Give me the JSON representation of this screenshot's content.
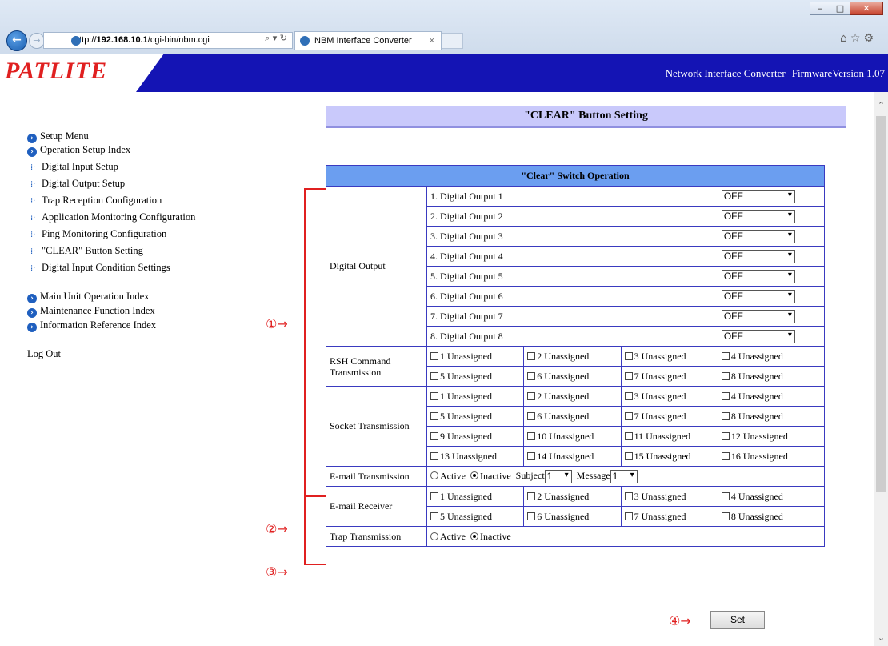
{
  "browser": {
    "url_prefix": "http://",
    "url_host": "192.168.10.1",
    "url_path": "/cgi-bin/nbm.cgi",
    "tab_title": "NBM Interface Converter"
  },
  "header": {
    "logo": "PATLITE",
    "product": "Network Interface Converter",
    "firmware": "FirmwareVersion 1.07"
  },
  "sidebar": {
    "setup_menu": "Setup Menu",
    "operation_index": "Operation Setup Index",
    "items": [
      "Digital Input Setup",
      "Digital Output Setup",
      "Trap Reception Configuration",
      "Application Monitoring Configuration",
      "Ping Monitoring Configuration",
      "\"CLEAR\" Button Setting",
      "Digital Input Condition Settings"
    ],
    "main_unit_index": "Main Unit Operation Index",
    "maintenance_index": "Maintenance Function Index",
    "info_index": "Information Reference Index",
    "logout": "Log Out"
  },
  "page": {
    "title": "\"CLEAR\" Button Setting",
    "table_header": "\"Clear\" Switch Operation"
  },
  "digital_output": {
    "label": "Digital Output",
    "rows": [
      {
        "name": "1. Digital Output 1",
        "value": "OFF"
      },
      {
        "name": "2. Digital Output 2",
        "value": "OFF"
      },
      {
        "name": "3. Digital Output 3",
        "value": "OFF"
      },
      {
        "name": "4. Digital Output 4",
        "value": "OFF"
      },
      {
        "name": "5. Digital Output 5",
        "value": "OFF"
      },
      {
        "name": "6. Digital Output 6",
        "value": "OFF"
      },
      {
        "name": "7. Digital Output 7",
        "value": "OFF"
      },
      {
        "name": "8. Digital Output 8",
        "value": "OFF"
      }
    ]
  },
  "rsh": {
    "label": "RSH Command Transmission",
    "items": [
      "1 Unassigned",
      "2 Unassigned",
      "3 Unassigned",
      "4 Unassigned",
      "5 Unassigned",
      "6 Unassigned",
      "7 Unassigned",
      "8 Unassigned"
    ]
  },
  "socket": {
    "label": "Socket Transmission",
    "items": [
      "1 Unassigned",
      "2 Unassigned",
      "3 Unassigned",
      "4 Unassigned",
      "5 Unassigned",
      "6 Unassigned",
      "7 Unassigned",
      "8 Unassigned",
      "9 Unassigned",
      "10 Unassigned",
      "11 Unassigned",
      "12 Unassigned",
      "13 Unassigned",
      "14 Unassigned",
      "15 Unassigned",
      "16 Unassigned"
    ]
  },
  "email": {
    "label": "E-mail Transmission",
    "active": "Active",
    "inactive": "Inactive",
    "subject_label": "Subject",
    "subject_value": "1",
    "message_label": "Message",
    "message_value": "1"
  },
  "email_receiver": {
    "label": "E-mail Receiver",
    "items": [
      "1 Unassigned",
      "2 Unassigned",
      "3 Unassigned",
      "4 Unassigned",
      "5 Unassigned",
      "6 Unassigned",
      "7 Unassigned",
      "8 Unassigned"
    ]
  },
  "trap": {
    "label": "Trap Transmission",
    "active": "Active",
    "inactive": "Inactive"
  },
  "annotations": {
    "a1": "①→",
    "a2": "②→",
    "a3": "③→",
    "a4": "④→"
  },
  "set_button": "Set",
  "colors": {
    "header_bg": "#1414b4",
    "logo": "#e02020",
    "table_header_bg": "#6b9ef0",
    "title_bg": "#c9c9fb",
    "annotation": "#e02020"
  }
}
